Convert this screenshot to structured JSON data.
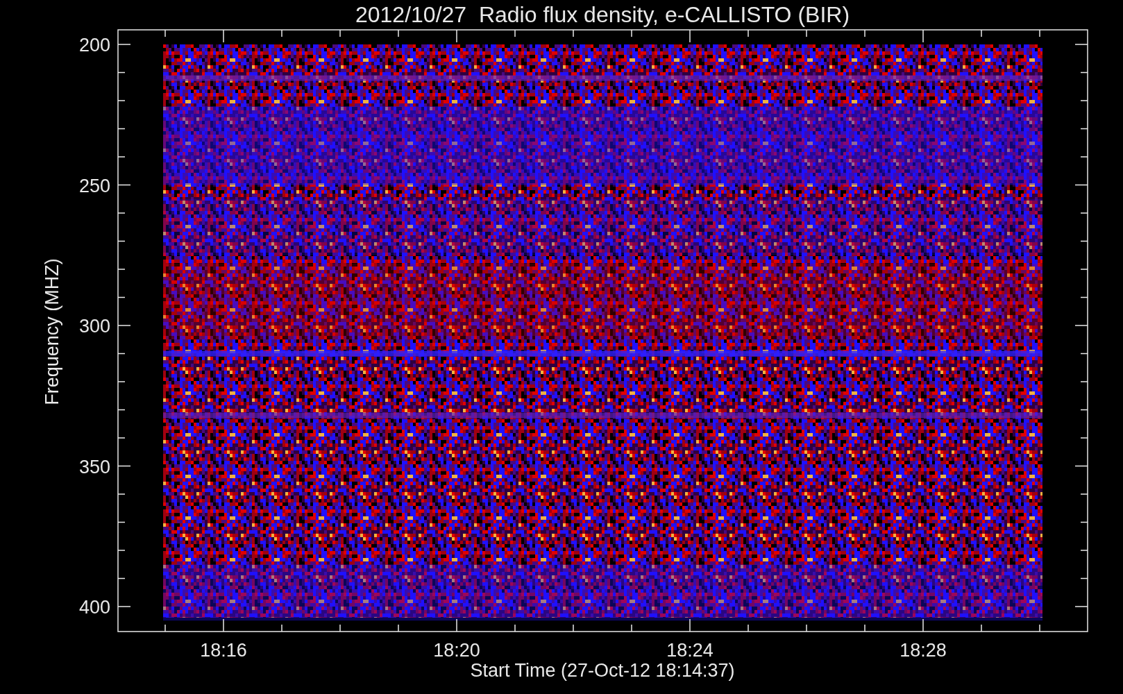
{
  "title": "2012/10/27  Radio flux density, e-CALLISTO (BIR)",
  "y_axis": {
    "label": "Frequency (MHZ)",
    "ticks": [
      "200",
      "250",
      "300",
      "350",
      "400"
    ]
  },
  "x_axis": {
    "label": "Start Time (27-Oct-12 18:14:37)",
    "ticks": [
      "18:16",
      "18:20",
      "18:24",
      "18:28"
    ]
  }
}
